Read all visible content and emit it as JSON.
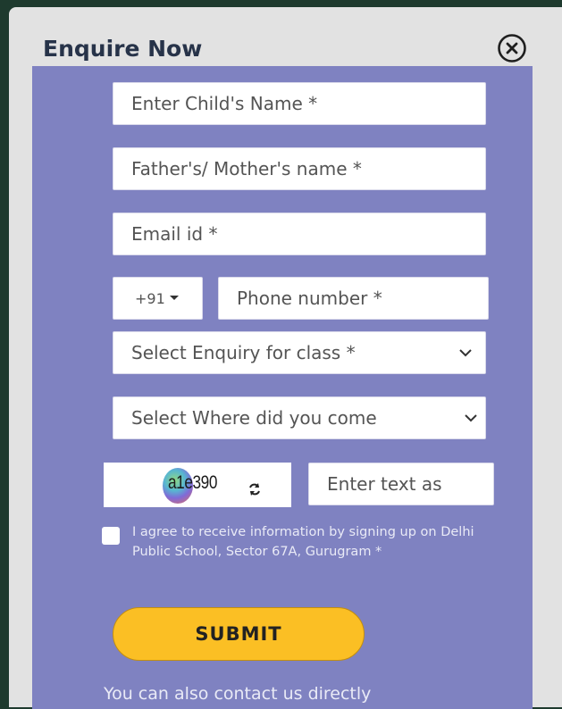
{
  "modal": {
    "title": "Enquire Now",
    "close_icon": "close-circle-icon"
  },
  "form": {
    "child_name_placeholder": "Enter Child's Name *",
    "parent_name_placeholder": "Father's/ Mother's name *",
    "email_placeholder": "Email id *",
    "country_code": "+91",
    "phone_placeholder": "Phone number *",
    "class_select_label": "Select Enquiry for class *",
    "source_select_label": "Select Where did you come",
    "captcha_text": "a1e390",
    "captcha_input_placeholder": "Enter text as",
    "agree_text": "I agree to receive information by signing up on Delhi Public School, Sector 67A, Gurugram *",
    "submit_label": "SUBMIT",
    "contact_text": "You can also contact us directly"
  },
  "colors": {
    "panel_bg": "#7f82c1",
    "modal_bg": "#e2e2e2",
    "submit_bg": "#fbbf24",
    "title_color": "#273349"
  }
}
